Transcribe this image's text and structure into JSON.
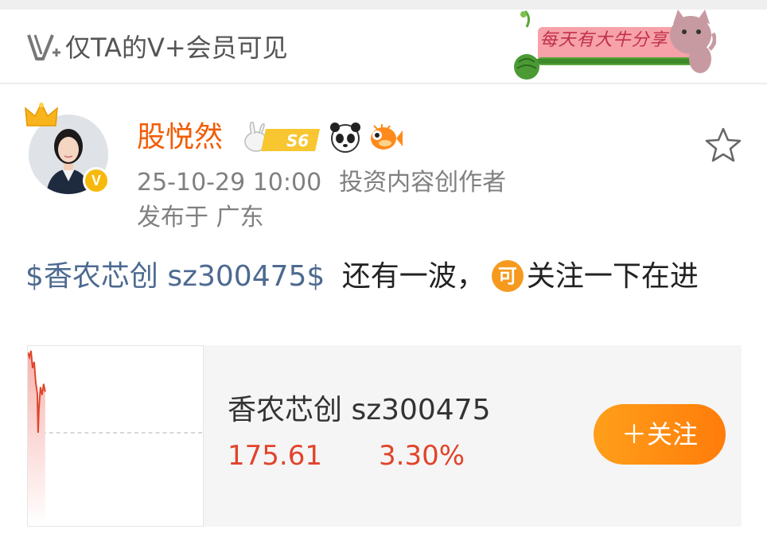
{
  "vip_bar": {
    "text": "仅TA的V+会员可见",
    "banner_text": "每天有大牛分享"
  },
  "author": {
    "name": "股悦然",
    "level_badge": "S6",
    "verified_mark": "V",
    "timestamp": "25-10-29 10:00",
    "role": "投资内容创作者",
    "location": "发布于 广东"
  },
  "post": {
    "stock_link": "$香农芯创 sz300475$",
    "text_1": "还有一波，",
    "inline_icon_text": "可",
    "text_2": "关注一下在进"
  },
  "stock_card": {
    "name": "香农芯创 sz300475",
    "price": "175.61",
    "change": "3.30%",
    "follow_label": "＋关注"
  },
  "icons": [
    "v-plus-logo-icon",
    "watermelon-cat-banner-icon",
    "crown-icon",
    "verified-icon",
    "rabbit-level-icon",
    "panda-icon",
    "pufferfish-icon",
    "star-icon"
  ],
  "colors": {
    "username": "#f25c05",
    "stock_link": "#4d6a90",
    "price_up": "#e0442b",
    "follow_button": "#ff8c12"
  }
}
